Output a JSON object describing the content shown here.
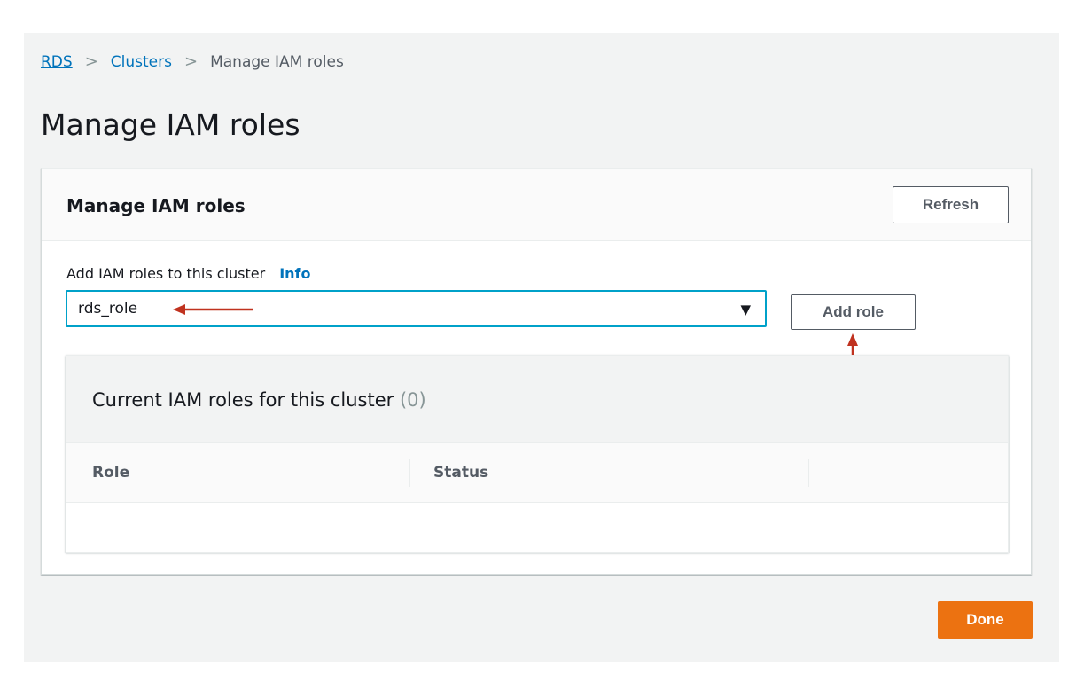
{
  "breadcrumb": {
    "items": [
      {
        "label": "RDS"
      },
      {
        "label": "Clusters"
      },
      {
        "label": "Manage IAM roles"
      }
    ]
  },
  "page": {
    "title": "Manage IAM roles"
  },
  "panel": {
    "title": "Manage IAM roles",
    "refresh_label": "Refresh",
    "field_label": "Add IAM roles to this cluster",
    "info_label": "Info",
    "selected_role": "rds_role",
    "add_role_label": "Add role",
    "current_roles": {
      "title": "Current IAM roles for this cluster",
      "count": "(0)",
      "columns": [
        "Role",
        "Status"
      ],
      "rows": []
    }
  },
  "footer": {
    "done_label": "Done"
  },
  "colors": {
    "primary": "#ec7211",
    "link": "#0073bb",
    "focus": "#00a1c9",
    "annotation_arrow": "#c0321f"
  },
  "icons": {
    "breadcrumb_separator": "chevron-right-icon",
    "select_caret": "caret-down-icon"
  }
}
